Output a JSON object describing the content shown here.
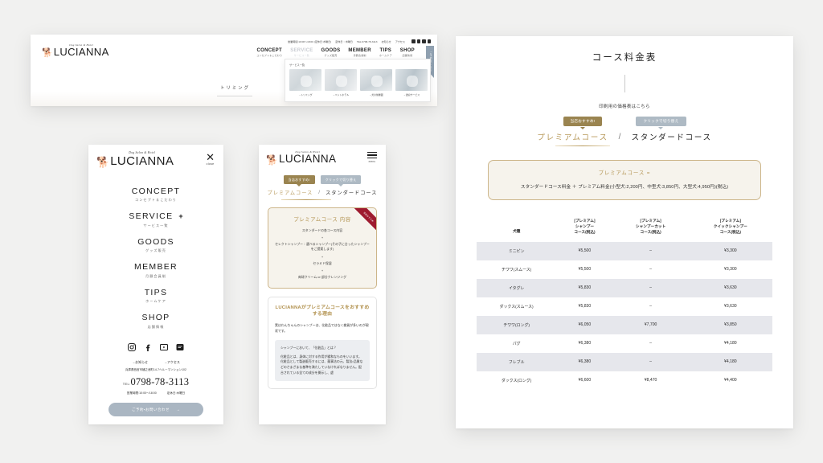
{
  "brand": {
    "name": "LUCIANNA",
    "tagline": "Dog Salon & Hotel",
    "logo_icon": "dog-logo-icon"
  },
  "desktop_panel": {
    "topbar": {
      "hours": "営業時間 10:00～18:00 (定休日:木曜日)",
      "access": "定休日：木曜日",
      "tel": "TEL:0798-78-3113",
      "news": "お知らせ",
      "access_link": "アクセス",
      "icons": [
        "instagram-icon",
        "facebook-icon",
        "youtube-icon",
        "line-icon"
      ]
    },
    "nav": [
      {
        "label": "CONCEPT",
        "sub": "コンセプト＆こだわり",
        "dim": false
      },
      {
        "label": "SERVICE",
        "sub": "サービス一覧",
        "dim": true
      },
      {
        "label": "GOODS",
        "sub": "グッズ販売",
        "dim": false
      },
      {
        "label": "MEMBER",
        "sub": "月額会員制",
        "dim": false
      },
      {
        "label": "TIPS",
        "sub": "ホームケア",
        "dim": false
      },
      {
        "label": "SHOP",
        "sub": "店舗情報",
        "dim": false
      }
    ],
    "ribbon": "ご予約はこちら",
    "dropdown": {
      "title": "サービス一覧",
      "items": [
        {
          "caption": "→トリミング"
        },
        {
          "caption": "→ペットホテル"
        },
        {
          "caption": "→犬の幼稚園"
        },
        {
          "caption": "→送迎サービス"
        }
      ]
    },
    "hero_word": "トリミング"
  },
  "mobile_menu": {
    "close_label": "close",
    "close_icon": "close-icon",
    "items": [
      {
        "label": "CONCEPT",
        "sub": "コンセプト＆こだわり",
        "plus": false,
        "sup": ""
      },
      {
        "label": "SERVICE",
        "sub": "サービス一覧",
        "plus": true,
        "sup": "*"
      },
      {
        "label": "GOODS",
        "sub": "グッズ販売",
        "plus": false,
        "sup": ""
      },
      {
        "label": "MEMBER",
        "sub": "月額会員制",
        "plus": false,
        "sup": ""
      },
      {
        "label": "TIPS",
        "sub": "ホームケア",
        "plus": false,
        "sup": ""
      },
      {
        "label": "SHOP",
        "sub": "店舗情報",
        "plus": false,
        "sup": ""
      }
    ],
    "social": [
      "instagram-icon",
      "facebook-icon",
      "youtube-icon",
      "line-icon"
    ],
    "links": [
      "→お知らせ",
      "→アクセス"
    ],
    "address": "兵庫県西宮市樋之池町14-7ヘルーマンション102",
    "tel_label": "TEL:",
    "tel": "0798-78-3113",
    "hours": "営業時間:10:00～18:00",
    "closed": "定休日:木曜日",
    "cta": "ご予約・お問い合わせ",
    "cta_arrow": "→"
  },
  "mobile_course": {
    "menu_label": "menu",
    "menu_icon": "hamburger-icon",
    "badge_recommend": "当店おすすめ!",
    "badge_switch": "クリックで切り替え",
    "tab_premium": "プレミアムコース",
    "tab_separator": "/",
    "tab_standard": "スタンダードコース",
    "box": {
      "corner_label": "当店おすすめ",
      "title": "プレミアムコース 内容",
      "line1": "スタンダードの各コース内容",
      "plus1": "+",
      "line2": "セレクトシャンプー：選べるシャンプー(その子に合ったシャンプーをご提案します)",
      "plus2": "+",
      "line3": "セラミド保湿",
      "plus3": "+",
      "line4": "肉球クリーム or 部分クレンジング"
    },
    "reason": {
      "title": "LUCIANNAがプレミアムコースをおすすめする理由",
      "body": "実はわんちゃんのシャンプーは、化粧品ではなく雑貨が多いのが現状です。",
      "quote_title": "シャンプーにおいて、「化粧品」とは？",
      "quote_body": "化粧品とは、身体に対する作用が緩和なものをいいます。\n化粧品として製造販売するには、薬事法の元、製法・品質などのさまざまな基準を満たしていなければなりません。配合されている全ての成分を開示し、虚"
    }
  },
  "price_panel": {
    "title": "コース料金表",
    "print_link": "印刷用の価格表はこちら",
    "badge_recommend": "当店おすすめ!",
    "badge_switch": "クリックで切り替え",
    "tab_premium": "プレミアムコース",
    "tab_separator": "/",
    "tab_standard": "スタンダードコース",
    "formula_title": "プレミアムコース =",
    "formula_body": "スタンダードコース料金 ＋ プレミアム料金(小型犬:2,200円、中型犬:3,850円、大型犬:4,950円)(税込)",
    "table": {
      "headers": [
        {
          "lines": [
            "犬種"
          ]
        },
        {
          "lines": [
            "[プレミアム]",
            "シャンプー",
            "コース(税込)"
          ]
        },
        {
          "lines": [
            "[プレミアム]",
            "シャンプーカット",
            "コース(税込)"
          ]
        },
        {
          "lines": [
            "[プレミアム]",
            "クイックシャンプー",
            "コース(税込)"
          ]
        }
      ],
      "rows": [
        {
          "breed": "ミニピン",
          "shampoo": "¥5,500",
          "cut": "–",
          "quick": "¥3,300"
        },
        {
          "breed": "チワワ(スムース)",
          "shampoo": "¥5,500",
          "cut": "–",
          "quick": "¥3,300"
        },
        {
          "breed": "イタグレ",
          "shampoo": "¥5,830",
          "cut": "–",
          "quick": "¥3,630"
        },
        {
          "breed": "ダックス(スムース)",
          "shampoo": "¥5,830",
          "cut": "–",
          "quick": "¥3,630"
        },
        {
          "breed": "チワワ(ロング)",
          "shampoo": "¥6,050",
          "cut": "¥7,700",
          "quick": "¥3,850"
        },
        {
          "breed": "パグ",
          "shampoo": "¥6,380",
          "cut": "–",
          "quick": "¥4,180"
        },
        {
          "breed": "フレブル",
          "shampoo": "¥6,380",
          "cut": "–",
          "quick": "¥4,180"
        },
        {
          "breed": "ダックス(ロング)",
          "shampoo": "¥6,600",
          "cut": "¥8,470",
          "quick": "¥4,400"
        }
      ]
    }
  },
  "colors": {
    "gold": "#b89a5c",
    "gold_badge": "#9a8450",
    "gray_badge": "#aebac4",
    "cream_bg": "#f6f3ec",
    "row_alt": "#e6e7ec",
    "page_bg": "#f1f1f0",
    "cta_blue": "#aab6c2",
    "corner_red": "#9e1b2f"
  }
}
